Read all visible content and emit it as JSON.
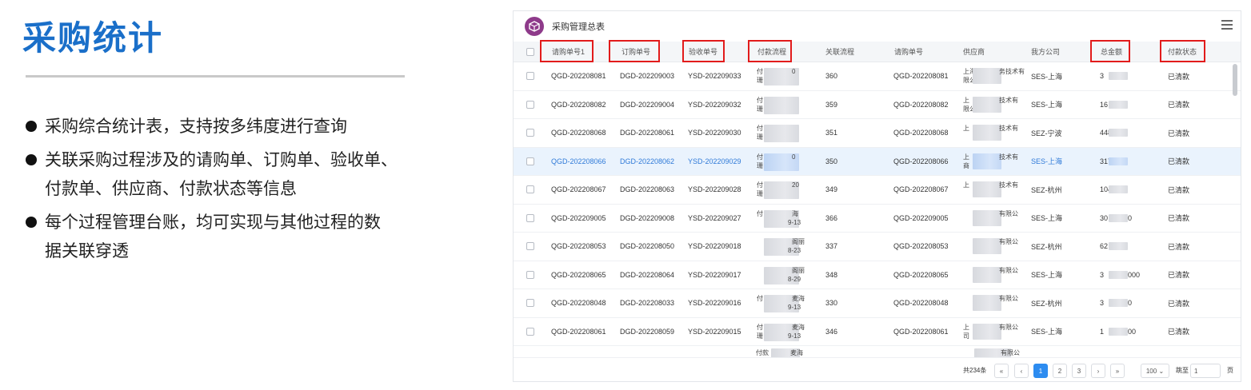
{
  "slide": {
    "title": "采购统计",
    "bullets": [
      {
        "line1": "采购综合统计表，支持按多纬度进行查询",
        "line2": ""
      },
      {
        "line1": "关联采购过程涉及的请购单、订购单、验收单、",
        "line2": "付款单、供应商、付款状态等信息"
      },
      {
        "line1": "每个过程管理台账，均可实现与其他过程的数",
        "line2": "据关联穿透"
      }
    ]
  },
  "app": {
    "title": "采购管理总表",
    "columns": {
      "req": "请购单号1",
      "order": "订购单号",
      "check": "验收单号",
      "pay": "付款流程",
      "flow": "关联流程",
      "req2": "请购单号",
      "supplier": "供应商",
      "company": "我方公司",
      "amount": "总金额",
      "status": "付款状态"
    },
    "rows": [
      {
        "req": "QGD-202208081",
        "order": "DGD-202209003",
        "check": "YSD-202209033",
        "pay1": "付",
        "pay2": "珊",
        "pay_tail": "0",
        "flow": "360",
        "req2": "QGD-202208081",
        "sup1": "上海",
        "sup_tail1": "务技术有",
        "sup2": "限公",
        "company": "SES-上海",
        "amt": "3",
        "amt_tail": "",
        "status": "已清款",
        "hl": false
      },
      {
        "req": "QGD-202208082",
        "order": "DGD-202209004",
        "check": "YSD-202209032",
        "pay1": "付",
        "pay2": "珊",
        "pay_tail": "",
        "flow": "359",
        "req2": "QGD-202208082",
        "sup1": "上",
        "sup_tail1": "技术有",
        "sup2": "限公",
        "company": "SES-上海",
        "amt": "16",
        "amt_tail": "",
        "status": "已清款",
        "hl": false
      },
      {
        "req": "QGD-202208068",
        "order": "DGD-202208061",
        "check": "YSD-202209030",
        "pay1": "付",
        "pay2": "珊",
        "pay_tail": "",
        "flow": "351",
        "req2": "QGD-202208068",
        "sup1": "上",
        "sup_tail1": "技术有",
        "sup2": "",
        "company": "SEZ-宁波",
        "amt": "448",
        "amt_tail": "",
        "status": "已清款",
        "hl": false
      },
      {
        "req": "QGD-202208066",
        "order": "DGD-202208062",
        "check": "YSD-202209029",
        "pay1": "付",
        "pay2": "珊",
        "pay_tail": "0",
        "flow": "350",
        "req2": "QGD-202208066",
        "sup1": "上",
        "sup_tail1": "技术有",
        "sup2": "商",
        "company": "SES-上海",
        "amt": "317",
        "amt_tail": "",
        "status": "已清款",
        "hl": true
      },
      {
        "req": "QGD-202208067",
        "order": "DGD-202208063",
        "check": "YSD-202209028",
        "pay1": "付",
        "pay2": "珊",
        "pay_tail": "20",
        "flow": "349",
        "req2": "QGD-202208067",
        "sup1": "上",
        "sup_tail1": "技术有",
        "sup2": "",
        "company": "SEZ-杭州",
        "amt": "104",
        "amt_tail": "",
        "status": "已清款",
        "hl": false
      },
      {
        "req": "QGD-202209005",
        "order": "DGD-202209008",
        "check": "YSD-202209027",
        "pay1": "付",
        "pay2": "",
        "pay_tail": "海",
        "pay_tail2": "9-13",
        "flow": "366",
        "req2": "QGD-202209005",
        "sup1": "",
        "sup_tail1": "有限公",
        "sup2": "",
        "company": "SES-上海",
        "amt": "30",
        "amt_tail": "0",
        "status": "已清款",
        "hl": false
      },
      {
        "req": "QGD-202208053",
        "order": "DGD-202208050",
        "check": "YSD-202209018",
        "pay1": "",
        "pay2": "",
        "pay_tail": "阁丽",
        "pay_tail2": "8-23",
        "flow": "337",
        "req2": "QGD-202208053",
        "sup1": "",
        "sup_tail1": "有限公",
        "sup2": "",
        "company": "SEZ-杭州",
        "amt": "62",
        "amt_tail": "",
        "status": "已清款",
        "hl": false
      },
      {
        "req": "QGD-202208065",
        "order": "DGD-202208064",
        "check": "YSD-202209017",
        "pay1": "",
        "pay2": "",
        "pay_tail": "阁丽",
        "pay_tail2": "8-29",
        "flow": "348",
        "req2": "QGD-202208065",
        "sup1": "",
        "sup_tail1": "有限公",
        "sup2": "",
        "company": "SES-上海",
        "amt": "3",
        "amt_tail": "000",
        "status": "已清款",
        "hl": false
      },
      {
        "req": "QGD-202208048",
        "order": "DGD-202208033",
        "check": "YSD-202209016",
        "pay1": "付",
        "pay2": "",
        "pay_tail": "麦海",
        "pay_tail2": "9-13",
        "flow": "330",
        "req2": "QGD-202208048",
        "sup1": "",
        "sup_tail1": "有限公",
        "sup2": "",
        "company": "SEZ-杭州",
        "amt": "3",
        "amt_tail": "0",
        "status": "已清款",
        "hl": false
      },
      {
        "req": "QGD-202208061",
        "order": "DGD-202208059",
        "check": "YSD-202209015",
        "pay1": "付",
        "pay2": "珊",
        "pay_tail": "麦海",
        "pay_tail2": "9-13",
        "flow": "346",
        "req2": "QGD-202208061",
        "sup1": "上",
        "sup_tail1": "有限公",
        "sup2": "司",
        "company": "SES-上海",
        "amt": "1",
        "amt_tail": "00",
        "status": "已清款",
        "hl": false
      }
    ],
    "partial_row": {
      "pay": "付款",
      "pay_tail": "麦海",
      "sup_tail": "有限公"
    },
    "pagination": {
      "total": "共234条",
      "pages": [
        "1",
        "2",
        "3"
      ],
      "page_size": "100",
      "goto_label": "跳至",
      "goto_value": "1",
      "page_suffix": "页"
    }
  }
}
